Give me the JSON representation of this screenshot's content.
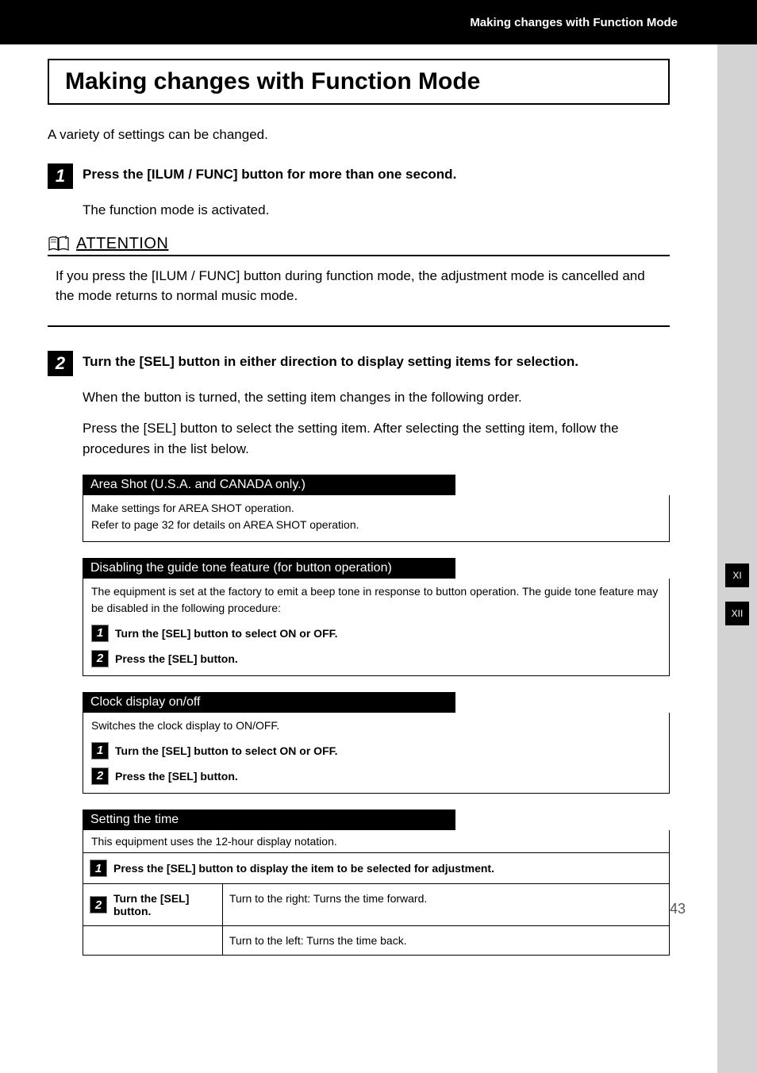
{
  "header": {
    "breadcrumb": "Making changes with Function Mode"
  },
  "title": "Making changes with Function Mode",
  "intro": "A variety of settings can be changed.",
  "step1": {
    "num": "1",
    "title": "Press the [ILUM / FUNC] button for more than one second.",
    "body": "The function mode is activated."
  },
  "attention": {
    "label": "ATTENTION",
    "body": "If you press the [ILUM / FUNC] button during function mode, the adjustment mode is cancelled and the mode returns to normal music mode."
  },
  "step2": {
    "num": "2",
    "title": "Turn the [SEL] button in either direction to display setting items for selection.",
    "body1": "When the button is turned, the setting item changes in the following order.",
    "body2": "Press the [SEL] button to select the setting item.  After selecting the setting item, follow the procedures in the list below."
  },
  "sections": {
    "area_shot": {
      "header": "Area Shot (U.S.A. and CANADA only.)",
      "line1": "Make settings for AREA SHOT operation.",
      "line2": "Refer to page 32 for details on AREA SHOT operation."
    },
    "guide_tone": {
      "header": "Disabling the guide tone feature (for button operation)",
      "intro": "The equipment is set at the factory to emit a beep tone in response to button operation. The guide tone feature may be disabled in the following procedure:",
      "s1_num": "1",
      "s1": "Turn the [SEL] button to select ON or OFF.",
      "s2_num": "2",
      "s2": "Press the [SEL] button."
    },
    "clock": {
      "header": "Clock display on/off",
      "intro": "Switches the clock display to ON/OFF.",
      "s1_num": "1",
      "s1": "Turn the [SEL] button to select ON or OFF.",
      "s2_num": "2",
      "s2": "Press the [SEL] button."
    },
    "time": {
      "header": "Setting the time",
      "intro": "This equipment uses the 12-hour display notation.",
      "s1_num": "1",
      "s1": "Press the [SEL] button to display the item to be selected for adjustment.",
      "s2_num": "2",
      "s2": "Turn the [SEL] button.",
      "right": "Turn to the right: Turns the time forward.",
      "left": "Turn to the left: Turns the time back."
    }
  },
  "tabs": {
    "t1": "XI",
    "t2": "XII"
  },
  "page_number": "43"
}
